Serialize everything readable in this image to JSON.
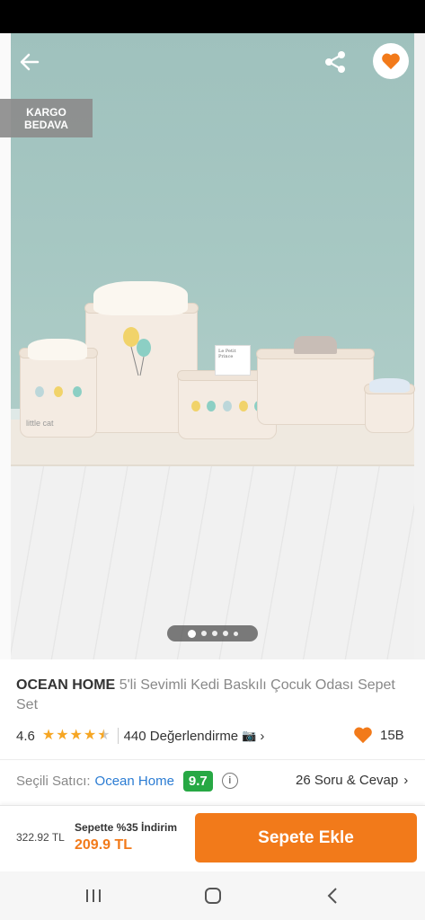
{
  "gallery": {
    "badge": "KARGO BEDAVA",
    "page_count": 5,
    "current_page": 1,
    "icons": {
      "back": "arrow-left-icon",
      "share": "share-icon",
      "favorite": "heart-icon"
    },
    "photo_props": {
      "box_label": "Le Petit Prince",
      "basket_print": "little cat"
    }
  },
  "product": {
    "brand": "OCEAN HOME",
    "name": "5'li Sevimli Kedi Baskılı Çocuk Odası Sepet Set",
    "rating": "4.6",
    "stars": 4.6,
    "reviews": "440 Değerlendirme",
    "likes": "15B"
  },
  "seller": {
    "label": "Seçili Satıcı:",
    "name": "Ocean Home",
    "score": "9.7",
    "qa": "26 Soru & Cevap"
  },
  "purchase": {
    "old_price": "322.92 TL",
    "discount_text": "Sepette %35 İndirim",
    "new_price": "209.9 TL",
    "cart_button": "Sepete Ekle"
  },
  "colors": {
    "accent": "#f27a1a",
    "seller_score": "#27a844",
    "link": "#2b7cd3"
  }
}
